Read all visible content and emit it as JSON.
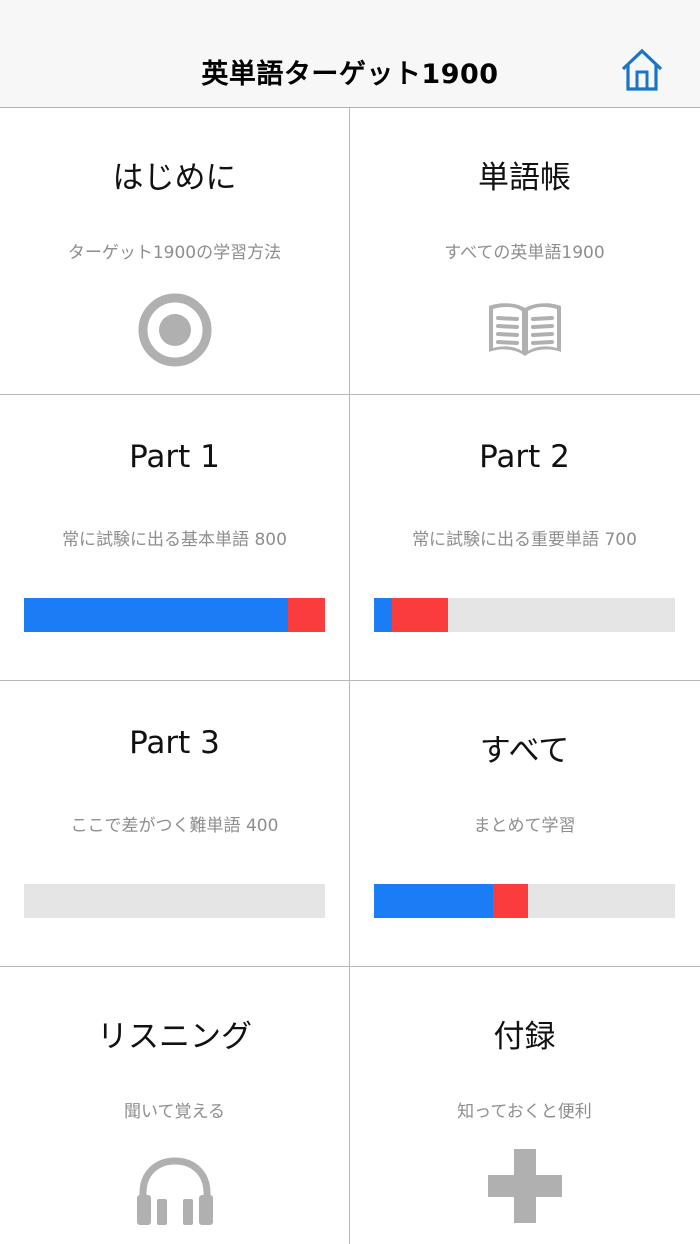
{
  "header": {
    "title": "英単語ターゲット1900",
    "home_icon": "home-icon"
  },
  "colors": {
    "blue": "#1a7df5",
    "red": "#fb3c3c",
    "track": "#e5e5e5",
    "icon_gray": "#b0b0b0",
    "home_blue": "#1a74c8"
  },
  "cells": [
    {
      "title": "はじめに",
      "subtitle": "ターゲット1900の学習方法",
      "icon": "target-icon"
    },
    {
      "title": "単語帳",
      "subtitle": "すべての英単語1900",
      "icon": "book-icon"
    },
    {
      "title": "Part 1",
      "subtitle": "常に試験に出る基本単語 800",
      "progress": {
        "blue": 0.877,
        "red": 0.123
      }
    },
    {
      "title": "Part 2",
      "subtitle": "常に試験に出る重要単語 700",
      "progress": {
        "blue": 0.06,
        "red": 0.186
      }
    },
    {
      "title": "Part 3",
      "subtitle": "ここで差がつく難単語 400",
      "progress": {
        "blue": 0,
        "red": 0
      }
    },
    {
      "title": "すべて",
      "subtitle": "まとめて学習",
      "progress": {
        "blue": 0.395,
        "red": 0.117
      }
    },
    {
      "title": "リスニング",
      "subtitle": "聞いて覚える",
      "icon": "headphones-icon"
    },
    {
      "title": "付録",
      "subtitle": "知っておくと便利",
      "icon": "plus-icon"
    }
  ]
}
